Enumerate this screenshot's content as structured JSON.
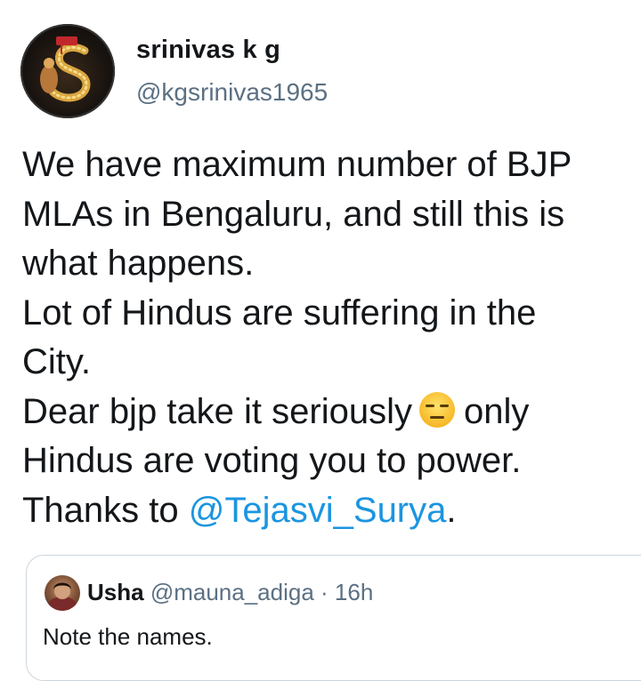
{
  "tweet": {
    "author": {
      "display_name": "srinivas k g",
      "handle": "@kgsrinivas1965",
      "avatar_icon": "profile-avatar-logo-icon"
    },
    "text_lines": [
      "We have maximum number of BJP",
      "MLAs in Bengaluru, and still this is",
      "what happens.",
      "Lot of Hindus are suffering in the",
      "City."
    ],
    "line6_before": "Dear bjp take it seriously",
    "line6_emoji": "expressionless-face-emoji",
    "line6_after": "only",
    "line7": "Hindus are voting you to power.",
    "line8_before": "Thanks to ",
    "mention": "@Tejasvi_Surya",
    "line8_after": "."
  },
  "quoted_tweet": {
    "display_name": "Usha",
    "handle": "@mauna_adiga",
    "separator": "·",
    "time": "16h",
    "text": "Note the names.",
    "avatar_icon": "quoted-user-avatar-icon"
  },
  "colors": {
    "link": "#1b95e0",
    "secondary_text": "#5b7083",
    "primary_text": "#14171a",
    "border": "#ccd6dd"
  }
}
